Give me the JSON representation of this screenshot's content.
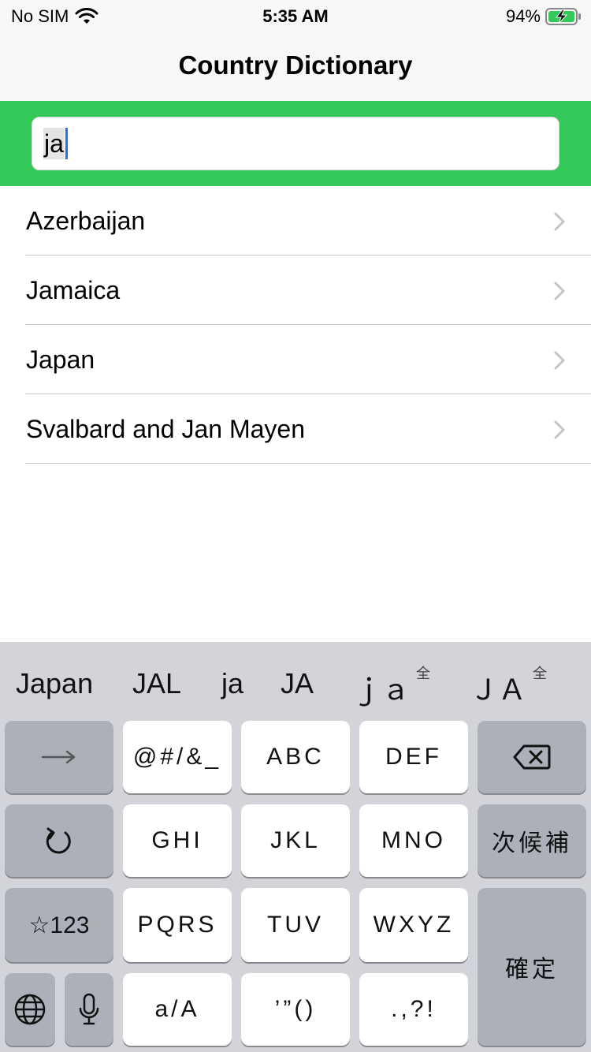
{
  "status_bar": {
    "carrier": "No SIM",
    "time": "5:35 AM",
    "battery_percent": "94%"
  },
  "nav": {
    "title": "Country Dictionary"
  },
  "search": {
    "value": "ja"
  },
  "countries": [
    {
      "name": "Azerbaijan"
    },
    {
      "name": "Jamaica"
    },
    {
      "name": "Japan"
    },
    {
      "name": "Svalbard and Jan Mayen"
    }
  ],
  "keyboard": {
    "candidates": [
      {
        "text": "Japan",
        "sup": ""
      },
      {
        "text": "JAL",
        "sup": ""
      },
      {
        "text": "ja",
        "sup": ""
      },
      {
        "text": "JA",
        "sup": ""
      },
      {
        "text": "ｊａ",
        "sup": "全"
      },
      {
        "text": "ＪＡ",
        "sup": "全"
      }
    ],
    "keys": {
      "symbols": "@#/&_",
      "abc": "ABC",
      "def": "DEF",
      "ghi": "GHI",
      "jkl": "JKL",
      "mno": "MNO",
      "next_candidate": "次候補",
      "num_mode": "☆123",
      "pqrs": "PQRS",
      "tuv": "TUV",
      "wxyz": "WXYZ",
      "confirm": "確定",
      "case_toggle": "a/A",
      "quotes": "’”()",
      "punct": ".,?!"
    },
    "icons": {
      "arrow": "right-arrow-icon",
      "delete": "delete-icon",
      "undo": "undo-icon",
      "globe": "globe-icon",
      "mic": "microphone-icon"
    }
  },
  "colors": {
    "accent_green": "#34c759",
    "caret_blue": "#1b74f0",
    "keyboard_bg": "#d2d4d9"
  }
}
